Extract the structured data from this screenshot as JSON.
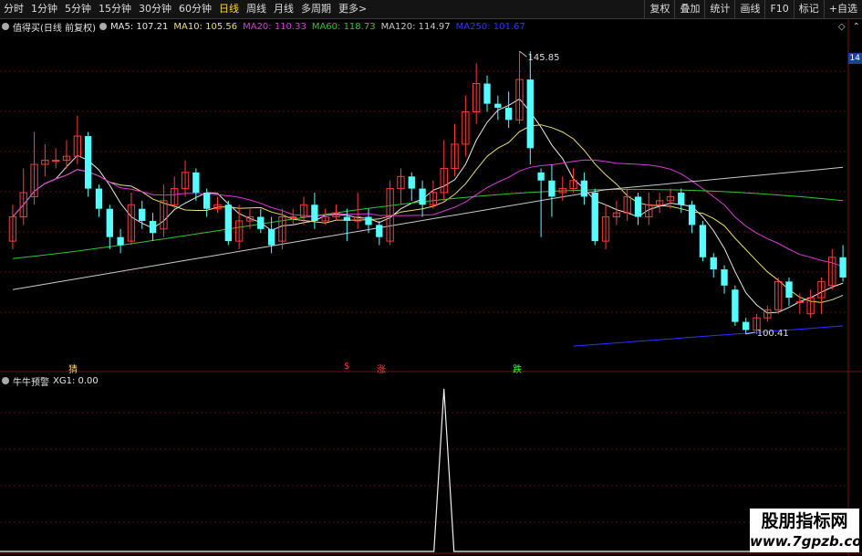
{
  "toolbar": {
    "periods": [
      "分时",
      "1分钟",
      "5分钟",
      "15分钟",
      "30分钟",
      "60分钟",
      "日线",
      "周线",
      "月线",
      "多周期",
      "更多>"
    ],
    "active_period": "日线",
    "right_buttons": [
      "复权",
      "叠加",
      "统计",
      "画线",
      "F10",
      "标记",
      "+自选"
    ]
  },
  "main_legend": {
    "title": "值得买(日线 前复权)",
    "ma5": "MA5: 107.21",
    "ma10": "MA10: 105.56",
    "ma20": "MA20: 110.33",
    "ma60": "MA60: 118.73",
    "ma120": "MA120: 114.97",
    "ma250": "MA250: 101.67"
  },
  "right_controls": {
    "diamond": "◇",
    "up": "⌃",
    "tag": "14"
  },
  "annotations": {
    "high": "145.85",
    "low": "100.41"
  },
  "signals": {
    "s1": "猜",
    "s2": "$",
    "s3": "涨",
    "s4": "跌"
  },
  "sub_legend": {
    "title": "牛牛预警",
    "value": "XG1: 0.00"
  },
  "watermark": {
    "line1": "股朋指标网",
    "line2": "www.7gpzb.com"
  },
  "colors": {
    "up": "#ff3b3b",
    "down": "#54ffff",
    "ma5": "#e8e8e8",
    "ma10": "#e8e070",
    "ma20": "#d83cd8",
    "ma60": "#35c435",
    "ma120": "#c8c8c8",
    "ma250": "#3030ff"
  },
  "chart_data": {
    "type": "candlestick",
    "candles": [
      {
        "o": 98,
        "c": 104,
        "h": 107,
        "l": 96
      },
      {
        "o": 104,
        "c": 110,
        "h": 116,
        "l": 102
      },
      {
        "o": 109,
        "c": 117,
        "h": 125,
        "l": 107
      },
      {
        "o": 117,
        "c": 118,
        "h": 122,
        "l": 114
      },
      {
        "o": 118,
        "c": 118,
        "h": 121,
        "l": 116
      },
      {
        "o": 118,
        "c": 119,
        "h": 123,
        "l": 116
      },
      {
        "o": 119,
        "c": 124,
        "h": 129,
        "l": 117
      },
      {
        "o": 124,
        "c": 111,
        "h": 125,
        "l": 109
      },
      {
        "o": 111,
        "c": 106,
        "h": 112,
        "l": 104
      },
      {
        "o": 106,
        "c": 99,
        "h": 107,
        "l": 96
      },
      {
        "o": 99,
        "c": 97,
        "h": 101,
        "l": 95
      },
      {
        "o": 98,
        "c": 107,
        "h": 110,
        "l": 97
      },
      {
        "o": 106,
        "c": 103,
        "h": 108,
        "l": 101
      },
      {
        "o": 103,
        "c": 100,
        "h": 105,
        "l": 98
      },
      {
        "o": 101,
        "c": 108,
        "h": 112,
        "l": 99
      },
      {
        "o": 107,
        "c": 111,
        "h": 114,
        "l": 106
      },
      {
        "o": 111,
        "c": 115,
        "h": 118,
        "l": 109
      },
      {
        "o": 115,
        "c": 110,
        "h": 116,
        "l": 108
      },
      {
        "o": 110,
        "c": 106,
        "h": 111,
        "l": 104
      },
      {
        "o": 106,
        "c": 107,
        "h": 109,
        "l": 105
      },
      {
        "o": 107,
        "c": 98,
        "h": 108,
        "l": 97
      },
      {
        "o": 98,
        "c": 103,
        "h": 107,
        "l": 96
      },
      {
        "o": 103,
        "c": 104,
        "h": 106,
        "l": 101
      },
      {
        "o": 104,
        "c": 101,
        "h": 106,
        "l": 100
      },
      {
        "o": 101,
        "c": 97,
        "h": 104,
        "l": 95
      },
      {
        "o": 98,
        "c": 104,
        "h": 106,
        "l": 96
      },
      {
        "o": 104,
        "c": 104,
        "h": 106,
        "l": 102
      },
      {
        "o": 104,
        "c": 107,
        "h": 109,
        "l": 102
      },
      {
        "o": 107,
        "c": 103,
        "h": 110,
        "l": 101
      },
      {
        "o": 103,
        "c": 104,
        "h": 106,
        "l": 102
      },
      {
        "o": 104,
        "c": 105,
        "h": 107,
        "l": 103
      },
      {
        "o": 104,
        "c": 103,
        "h": 106,
        "l": 98
      },
      {
        "o": 103,
        "c": 104,
        "h": 110,
        "l": 101
      },
      {
        "o": 104,
        "c": 102,
        "h": 106,
        "l": 100
      },
      {
        "o": 102,
        "c": 99,
        "h": 103,
        "l": 97
      },
      {
        "o": 98,
        "c": 111,
        "h": 113,
        "l": 97
      },
      {
        "o": 111,
        "c": 114,
        "h": 116,
        "l": 107
      },
      {
        "o": 114,
        "c": 111,
        "h": 115,
        "l": 108
      },
      {
        "o": 111,
        "c": 107,
        "h": 113,
        "l": 104
      },
      {
        "o": 107,
        "c": 110,
        "h": 113,
        "l": 106
      },
      {
        "o": 110,
        "c": 116,
        "h": 123,
        "l": 108
      },
      {
        "o": 116,
        "c": 122,
        "h": 127,
        "l": 114
      },
      {
        "o": 122,
        "c": 130,
        "h": 134,
        "l": 119
      },
      {
        "o": 130,
        "c": 137,
        "h": 142,
        "l": 127
      },
      {
        "o": 137,
        "c": 132,
        "h": 139,
        "l": 130
      },
      {
        "o": 132,
        "c": 131,
        "h": 134,
        "l": 128
      },
      {
        "o": 131,
        "c": 128,
        "h": 135,
        "l": 126
      },
      {
        "o": 128,
        "c": 138,
        "h": 145,
        "l": 127
      },
      {
        "o": 138,
        "c": 121,
        "h": 145,
        "l": 117
      },
      {
        "o": 115,
        "c": 113,
        "h": 116,
        "l": 99
      },
      {
        "o": 113,
        "c": 109,
        "h": 117,
        "l": 104
      },
      {
        "o": 110,
        "c": 111,
        "h": 114,
        "l": 108
      },
      {
        "o": 111,
        "c": 113,
        "h": 116,
        "l": 110
      },
      {
        "o": 113,
        "c": 109,
        "h": 115,
        "l": 107
      },
      {
        "o": 110,
        "c": 98,
        "h": 111,
        "l": 97
      },
      {
        "o": 98,
        "c": 104,
        "h": 107,
        "l": 96
      },
      {
        "o": 104,
        "c": 105,
        "h": 108,
        "l": 102
      },
      {
        "o": 105,
        "c": 109,
        "h": 111,
        "l": 103
      },
      {
        "o": 109,
        "c": 104,
        "h": 110,
        "l": 102
      },
      {
        "o": 104,
        "c": 107,
        "h": 110,
        "l": 102
      },
      {
        "o": 107,
        "c": 108,
        "h": 110,
        "l": 105
      },
      {
        "o": 108,
        "c": 109,
        "h": 111,
        "l": 106
      },
      {
        "o": 110,
        "c": 107,
        "h": 111,
        "l": 105
      },
      {
        "o": 107,
        "c": 102,
        "h": 108,
        "l": 100
      },
      {
        "o": 102,
        "c": 94,
        "h": 103,
        "l": 93
      },
      {
        "o": 94,
        "c": 91,
        "h": 95,
        "l": 89
      },
      {
        "o": 91,
        "c": 87,
        "h": 92,
        "l": 85
      },
      {
        "o": 86,
        "c": 78,
        "h": 87,
        "l": 77
      },
      {
        "o": 78,
        "c": 76,
        "h": 79,
        "l": 75
      },
      {
        "o": 76,
        "c": 79,
        "h": 80,
        "l": 75
      },
      {
        "o": 79,
        "c": 81,
        "h": 82,
        "l": 78
      },
      {
        "o": 81,
        "c": 88,
        "h": 89,
        "l": 80
      },
      {
        "o": 88,
        "c": 84,
        "h": 89,
        "l": 82
      },
      {
        "o": 83,
        "c": 83,
        "h": 85,
        "l": 80
      },
      {
        "o": 80,
        "c": 84,
        "h": 86,
        "l": 79
      },
      {
        "o": 84,
        "c": 88,
        "h": 89,
        "l": 80
      },
      {
        "o": 87,
        "c": 94,
        "h": 96,
        "l": 86
      },
      {
        "o": 94,
        "c": 89,
        "h": 97,
        "l": 88
      }
    ],
    "indicator": {
      "name": "XG1",
      "spike_index": 40,
      "spike_value": 1
    }
  }
}
